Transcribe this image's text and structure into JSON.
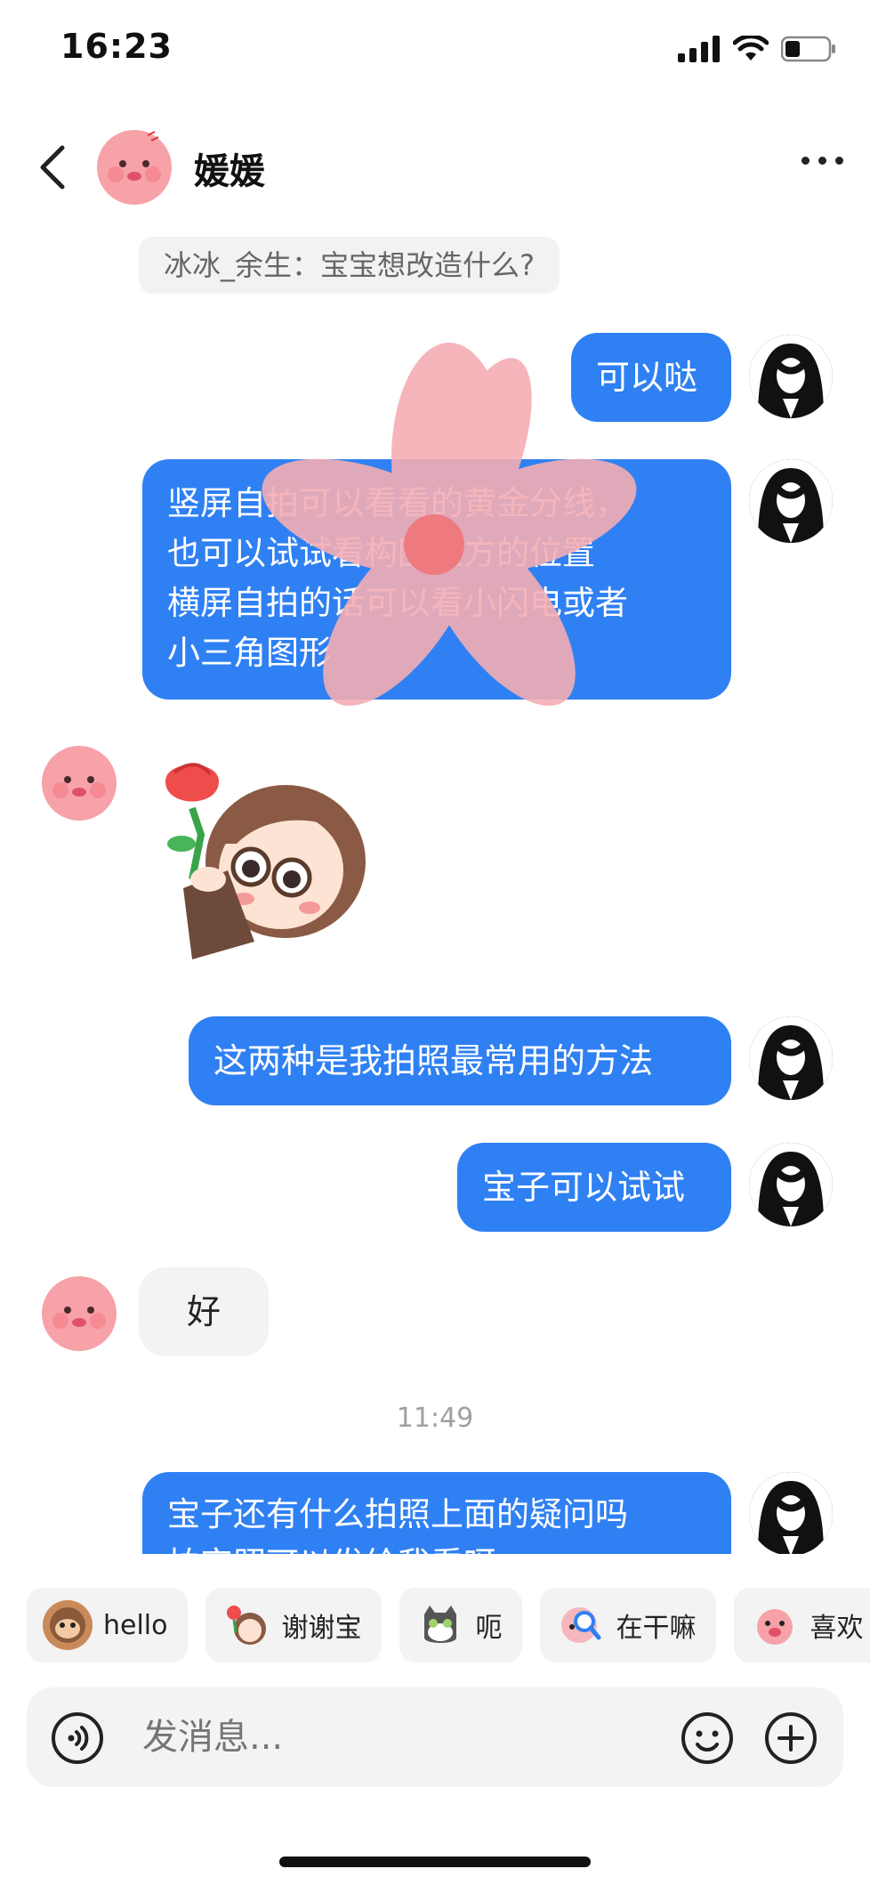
{
  "status_bar": {
    "time": "16:23"
  },
  "header": {
    "contact_name": "媛媛"
  },
  "quoted_reply": "冰冰_余生：宝宝想改造什么?",
  "messages": [
    {
      "side": "right",
      "text": "可以哒"
    },
    {
      "side": "right",
      "lines": [
        "竖屏自拍可以看看的黄金分线，",
        "也可以试试看构图上方的位置",
        "横屏自拍的话可以看小闪电或者",
        "小三角图形"
      ]
    },
    {
      "side": "left",
      "sticker": "girl-holding-rose-sticker"
    },
    {
      "side": "right",
      "text": "这两种是我拍照最常用的方法"
    },
    {
      "side": "right",
      "text": "宝子可以试试"
    },
    {
      "side": "left",
      "text": "好"
    },
    {
      "side": "right",
      "lines": [
        "宝子还有什么拍照上面的疑问吗",
        "拍完照可以发给我看呀"
      ]
    }
  ],
  "timestamp": "11:49",
  "quick_replies": [
    {
      "label": "hello",
      "icon": "monkey-emoji-icon"
    },
    {
      "label": "谢谢宝",
      "icon": "girl-rose-emoji-icon"
    },
    {
      "label": "呃",
      "icon": "cat-emoji-icon"
    },
    {
      "label": "在干嘛",
      "icon": "magnifier-emoji-icon"
    },
    {
      "label": "喜欢",
      "icon": "pig-emoji-icon"
    }
  ],
  "composer": {
    "placeholder": "发消息..."
  },
  "colors": {
    "my_bubble": "#2f80f3",
    "their_bubble": "#f3f3f3",
    "accent_pink": "#f6a2a8"
  }
}
